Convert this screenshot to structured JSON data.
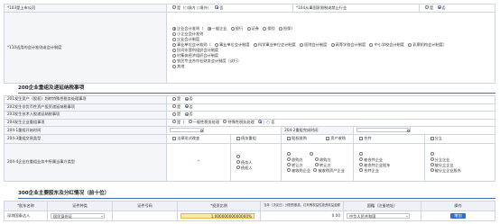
{
  "basic": {
    "row1": {
      "label": "*103是上市公司",
      "opt_yes": "是（○境内 ○境外）",
      "opt_no": "否",
      "right_label": "*104从事国家限制或禁止行业",
      "right_yes": "是",
      "right_no": "否"
    },
    "accounting": {
      "label": "*110适用的会计准则或会计制度",
      "line1": [
        "企业会计准则（",
        "一般企业",
        "银行",
        "证券",
        "保险",
        "担保",
        "）"
      ],
      "line2": "小企业会计准则",
      "line3": "企业会计制度",
      "line4": [
        "事业单位会计准则（",
        "事业单位会计制度",
        "科学事业单位会计制度",
        "医院会计制度",
        "高等学校会计制度",
        "中小学校会计制度",
        "彩票机构会计制度",
        "）"
      ],
      "line5": "民间非营利组织会计制度",
      "line6": "村集体经济组织会计制度",
      "line7": "农民专业合作社财务会计制度（试行）",
      "line8": "其他"
    }
  },
  "sec200": {
    "title": "200企业重组及递延纳税事项",
    "rows": [
      {
        "label": "201发生资产（股权）划转特殊性税务处理事项",
        "yes": "是",
        "no": "否"
      },
      {
        "label": "202发生非货币性资产投资递延纳税事项",
        "yes": "是",
        "no": "否"
      },
      {
        "label": "203发生技术入股递延纳税事项",
        "yes": "是",
        "no": "否"
      },
      {
        "label": "204发生企业重组事项",
        "yes": "是（",
        "general": "一般性税务处理",
        "special": "特殊性税务处理",
        "no": "）○ 否"
      }
    ],
    "row205": {
      "left": "204-1重组开始时间",
      "right": "204-2重组完成时间"
    },
    "row206": {
      "label": "204-3重组交易类型",
      "opts": [
        "法律形式改变",
        "债务重组",
        "股权收购",
        "资产收购",
        "合并",
        "分立"
      ]
    },
    "row207": {
      "label": "204-4企业在重组业务中所属当事方类型",
      "col1": [
        "",
        "债务人",
        "债权人",
        ""
      ],
      "col2": [
        "",
        "收购方",
        "转让方",
        "被收购企业"
      ],
      "col3": [
        "",
        "收购方",
        "转让方",
        "被收购资产企业"
      ],
      "col4": [
        "",
        "被合并企业",
        "被合并企业股东",
        "合并企业"
      ],
      "col5": [
        "",
        "分立企业",
        "被分立企业",
        "被分立企业股东"
      ]
    }
  },
  "sec300": {
    "title": "300企业主要股东及分红情况（前十位）",
    "headers": [
      "*股东名称",
      "证件种类",
      "证件号码",
      "*投资比例",
      "当年（决议日）分配的股息、红利等权益性投资收益金额",
      "国籍（注册地址）",
      "操作"
    ],
    "row": {
      "name": "深圳国泰达人",
      "id_type": "居民身份证",
      "ratio": "1.00000000000000%",
      "dividend": "0.00",
      "country": "中华人民共和国",
      "action": "增加"
    }
  }
}
